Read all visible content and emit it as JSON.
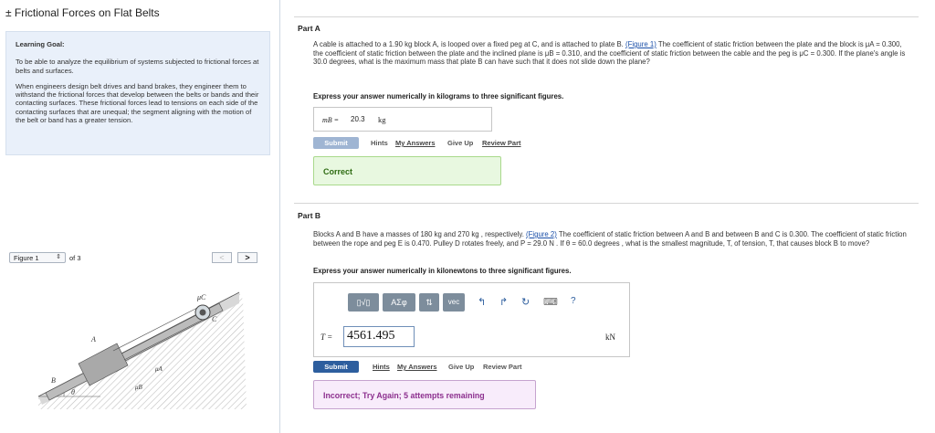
{
  "header": {
    "title": "± Frictional Forces on Flat Belts"
  },
  "learning_goal": {
    "heading": "Learning Goal:",
    "para1": "To be able to analyze the equilibrium of systems subjected to frictional forces at belts and surfaces.",
    "para2": "When engineers design belt drives and band brakes, they engineer them to withstand the frictional forces that develop between the belts or bands and their contacting surfaces. These frictional forces lead to tensions on each side of the contacting surfaces that are unequal; the segment aligning with the motion of the belt or band has a greater tension."
  },
  "figure_nav": {
    "selected": "Figure 1",
    "of_text": "of 3",
    "prev": "<",
    "next": ">"
  },
  "figure": {
    "labels": {
      "mu_c": "μC",
      "c": "C",
      "a": "A",
      "mu_a": "μA",
      "b": "B",
      "mu_b": "μB",
      "theta": "θ"
    }
  },
  "part_a": {
    "heading": "Part A",
    "text_1": "A cable is attached to a 1.90 kg block A, is looped over a fixed peg at C, and is attached to plate B.",
    "figure_link": "(Figure 1)",
    "text_2": "The coefficient of static friction between the plate and the block is μA = 0.300, the coefficient of static friction between the plate and the inclined plane is μB = 0.310, and the coefficient of static friction between the cable and the peg is μC = 0.300. If the plane's angle is 30.0 degrees, what is the maximum mass that plate B can have such that it does not slide down the plane?",
    "instruction": "Express your answer numerically in kilograms to three significant figures.",
    "answer_label": "mB =",
    "answer_value": "20.3",
    "answer_unit": "kg",
    "submit": "Submit",
    "hints": "Hints",
    "my_answers": "My Answers",
    "give_up": "Give Up",
    "review_part": "Review Part",
    "feedback": "Correct"
  },
  "part_b": {
    "heading": "Part B",
    "text_1": "Blocks A and B have a masses of 180 kg and 270 kg , respectively.",
    "figure_link": "(Figure 2)",
    "text_2": "The coefficient of static friction between A and B and between B and C is 0.300. The coefficient of static friction between the rope and peg E is 0.470. Pulley D rotates freely, and P = 29.0 N . If θ = 60.0 degrees , what is the smallest magnitude, T, of tension, T, that causes block B to move?",
    "instruction": "Express your answer numerically in kilonewtons to three significant figures.",
    "toolbar": {
      "templates": "▯√▯",
      "symbols": "ΑΣφ",
      "arrows": "⇅",
      "vec": "vec",
      "undo": "↰",
      "redo": "↱",
      "reset": "↻",
      "keyboard": "⌨",
      "help": "?"
    },
    "answer_label": "T =",
    "answer_value": "4561.495",
    "answer_unit": "kN",
    "submit": "Submit",
    "hints": "Hints",
    "my_answers": "My Answers",
    "give_up": "Give Up",
    "review_part": "Review Part",
    "feedback": "Incorrect; Try Again; 5 attempts remaining"
  }
}
